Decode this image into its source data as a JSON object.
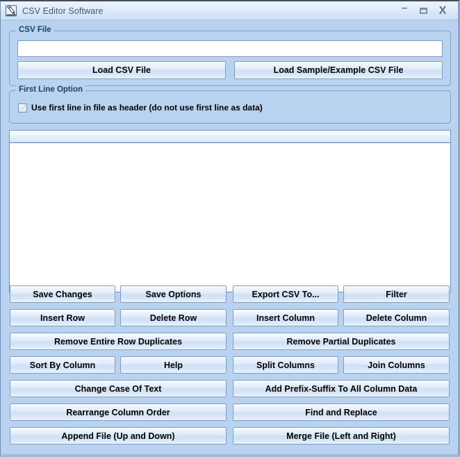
{
  "window": {
    "title": "CSV Editor Software",
    "icon": "pencil-edit-icon",
    "minimize_label": "–",
    "maximize_label": "",
    "close_label": "X"
  },
  "csv_file_group": {
    "legend": "CSV File",
    "path_input": {
      "value": "",
      "placeholder": ""
    },
    "load_csv_button": "Load CSV File",
    "load_sample_button": "Load Sample/Example CSV File"
  },
  "first_line_group": {
    "legend": "First Line Option",
    "checkbox": {
      "label": "Use first line in file as header (do not use first line as data)",
      "checked": true
    }
  },
  "grid": {
    "header_columns": [],
    "rows": []
  },
  "actions": {
    "row1": [
      "Save Changes",
      "Save Options",
      "Export CSV To...",
      "Filter"
    ],
    "row2": [
      "Insert Row",
      "Delete Row",
      "Insert Column",
      "Delete Column"
    ],
    "row3": [
      "Remove Entire Row Duplicates",
      "Remove Partial Duplicates"
    ],
    "row4": [
      "Sort By Column",
      "Help",
      "Split Columns",
      "Join Columns"
    ],
    "row5": [
      "Change Case Of Text",
      "Add Prefix-Suffix To All Column Data"
    ],
    "row6": [
      "Rearrange Column Order",
      "Find and Replace"
    ],
    "row7": [
      "Append File (Up and Down)",
      "Merge File (Left and Right)"
    ]
  },
  "colors": {
    "window_background": "#b9d2f0",
    "titlebar_top": "#eaf2fb",
    "legend_text": "#1c3f6e",
    "button_border": "#7e9ec4",
    "grid_background": "#ffffff"
  }
}
